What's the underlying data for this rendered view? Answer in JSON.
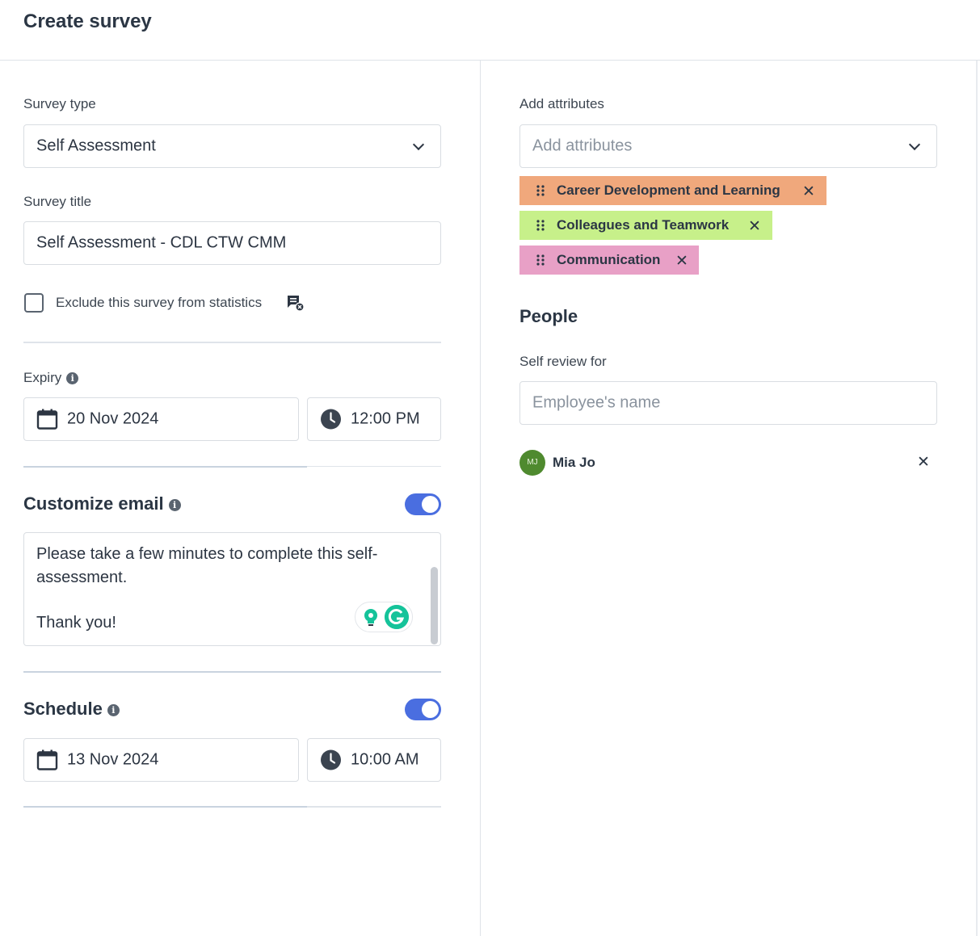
{
  "header": {
    "title": "Create survey"
  },
  "left": {
    "survey_type": {
      "label": "Survey type",
      "value": "Self Assessment"
    },
    "survey_title": {
      "label": "Survey title",
      "value": "Self Assessment - CDL CTW CMM"
    },
    "exclude": {
      "label": "Exclude this survey from statistics",
      "checked": false
    },
    "expiry": {
      "label": "Expiry",
      "date": "20 Nov 2024",
      "time": "12:00 PM"
    },
    "customize_email": {
      "title": "Customize email",
      "enabled": true,
      "body": "Please take a few minutes to complete this self-assessment.",
      "closing": "Thank you!"
    },
    "schedule": {
      "title": "Schedule",
      "enabled": true,
      "date": "13 Nov 2024",
      "time": "10:00 AM"
    }
  },
  "right": {
    "attributes": {
      "label": "Add attributes",
      "placeholder": "Add attributes",
      "tags": [
        {
          "label": "Career Development and Learning",
          "color": "#f0a87c"
        },
        {
          "label": "Colleagues and Teamwork",
          "color": "#c7f08a"
        },
        {
          "label": "Communication",
          "color": "#e8a0c6"
        }
      ]
    },
    "people": {
      "title": "People",
      "self_review_label": "Self review for",
      "placeholder": "Employee's name",
      "selected": [
        {
          "initials": "MJ",
          "name": "Mia Jo"
        }
      ]
    }
  },
  "colors": {
    "accent": "#4a6ee0",
    "avatar": "#4f8a2f"
  }
}
